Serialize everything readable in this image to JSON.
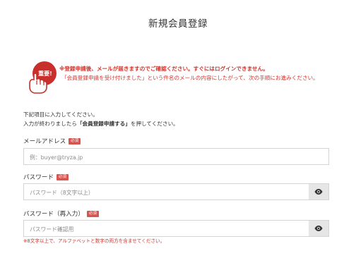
{
  "page": {
    "title": "新規会員登録"
  },
  "notice": {
    "icon_text": "重要!",
    "line1": "※登録申請後、メールが届きますのでご確認ください。すぐにはログインできません。",
    "line2": "「会員登録申請を受け付けました」という件名のメールの内容にしたがって、次の手順にお進みください。",
    "accent_color": "#d0342c"
  },
  "intro": {
    "line1": "下記項目に入力してください。",
    "line2_prefix": "入力が終わりましたら",
    "line2_bold": "「会員登録申請する」",
    "line2_suffix": "を押してください。"
  },
  "form": {
    "required_badge": "必須",
    "email": {
      "label": "メールアドレス",
      "placeholder": "例：buyer@tryza.jp",
      "value": ""
    },
    "password": {
      "label": "パスワード",
      "placeholder": "パスワード（8文字以上）",
      "value": "",
      "toggle_icon": "eye-icon"
    },
    "password_confirm": {
      "label": "パスワード（再入力）",
      "placeholder": "パスワード確認用",
      "value": "",
      "toggle_icon": "eye-icon"
    },
    "password_hint": "※8文字以上で、アルファベットと数字の両方を含ませてください。"
  }
}
